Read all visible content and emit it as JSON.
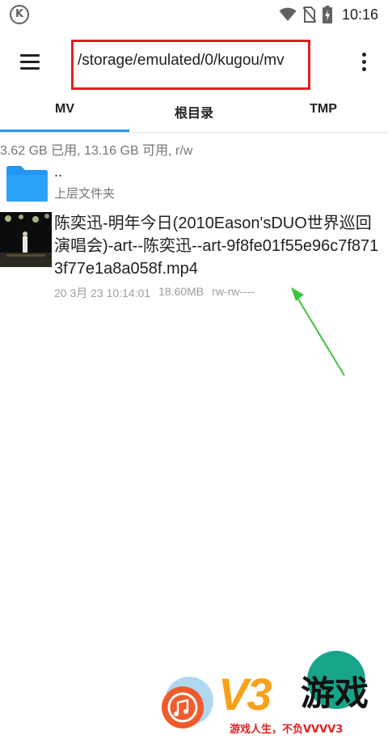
{
  "status_bar": {
    "app_badge": "K",
    "time": "10:16",
    "icons": [
      "wifi-icon",
      "no-sim-icon",
      "battery-charging-icon"
    ]
  },
  "toolbar": {
    "menu_icon": "hamburger-menu-icon",
    "path": "/storage/emulated/0/kugou/mv",
    "highlight_color": "#e02020",
    "more_icon": "more-vert-icon"
  },
  "tabs": [
    {
      "label": "MV",
      "active": true
    },
    {
      "label": "根目录",
      "active": false
    },
    {
      "label": "TMP",
      "active": false
    }
  ],
  "accent_color": "#2196f3",
  "storage_info": "3.62 GB 已用, 13.16 GB 可用, r/w",
  "items": [
    {
      "type": "parent-folder",
      "icon": "folder-icon",
      "name": "..",
      "subtitle": "上层文件夹"
    },
    {
      "type": "file",
      "icon": "video-thumbnail",
      "name": "陈奕迅-明年今日(2010Eason'sDUO世界巡回演唱会)-art--陈奕迅--art-9f8fe01f55e96c7f8713f77e1a8a058f.mp4",
      "date": "20 3月 23 10:14:01",
      "size": "18.60MB",
      "permissions": "rw-rw----"
    }
  ],
  "annotation": {
    "arrow_color": "#3cc43c"
  },
  "watermark": {
    "brand": "V3",
    "brand_cn": "游戏",
    "slogan": "游戏人生，不负VVVV3"
  }
}
